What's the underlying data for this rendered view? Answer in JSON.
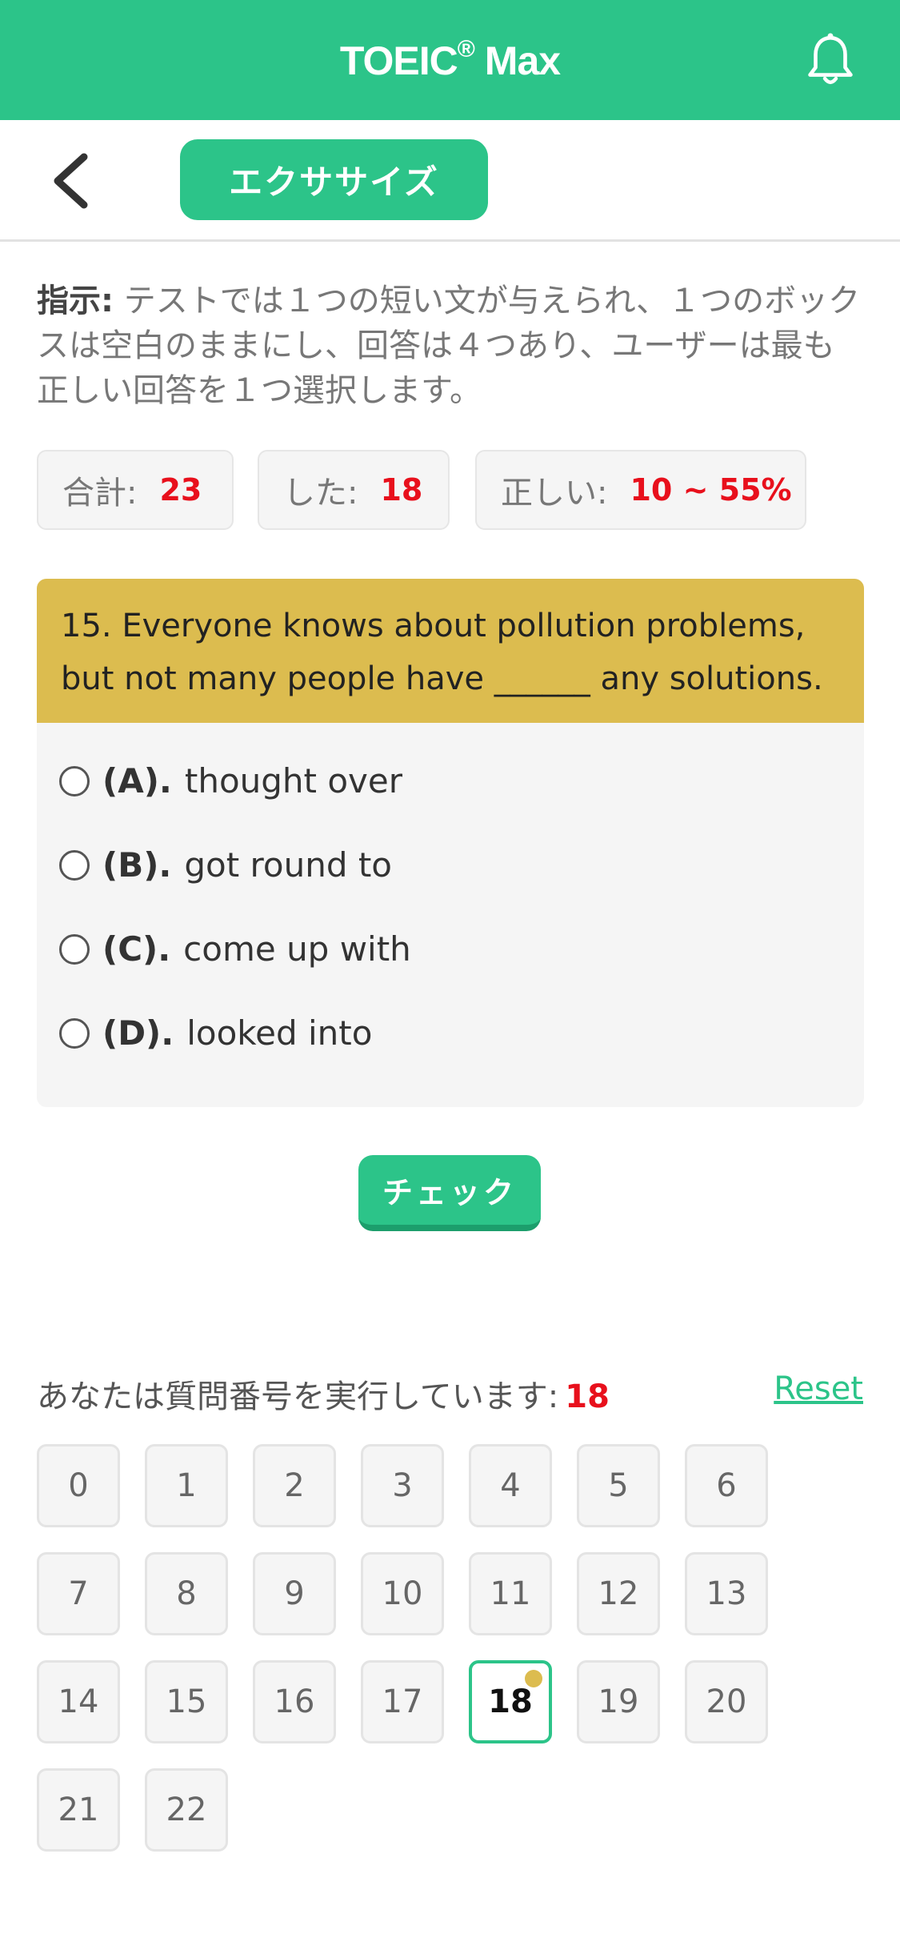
{
  "header": {
    "title": "TOEIC",
    "title_mark": "®",
    "title_suffix": " Max",
    "bell_icon": "bell-icon"
  },
  "subheader": {
    "back_icon": "chevron-left-icon",
    "tab_label": "エクササイズ"
  },
  "instructions": {
    "label": "指示:",
    "text": " テストでは１つの短い文が与えられ、１つのボックスは空白のままにし、回答は４つあり、ユーザーは最も正しい回答を１つ選択します。"
  },
  "stats": {
    "total_label": "合計:",
    "total_value": "23",
    "done_label": "した:",
    "done_value": "18",
    "correct_label": "正しい:",
    "correct_value": "10 ~ 55%"
  },
  "question": {
    "text": "15. Everyone knows about pollution problems, but not many people have ______ any solutions.",
    "options": [
      {
        "letter": "(A).",
        "text": "thought over"
      },
      {
        "letter": "(B).",
        "text": "got round to"
      },
      {
        "letter": "(C).",
        "text": "come up with"
      },
      {
        "letter": "(D).",
        "text": "looked into"
      }
    ]
  },
  "check_label": "チェック",
  "progress": {
    "label": "あなたは質問番号を実行しています:",
    "current": "18",
    "reset_label": "Reset"
  },
  "numbers": [
    "0",
    "1",
    "2",
    "3",
    "4",
    "5",
    "6",
    "7",
    "8",
    "9",
    "10",
    "11",
    "12",
    "13",
    "14",
    "15",
    "16",
    "17",
    "18",
    "19",
    "20",
    "21",
    "22"
  ],
  "active_number": "18",
  "colors": {
    "brand": "#2cc489",
    "question_header": "#dcbc4f",
    "accent_red": "#e8101c"
  }
}
